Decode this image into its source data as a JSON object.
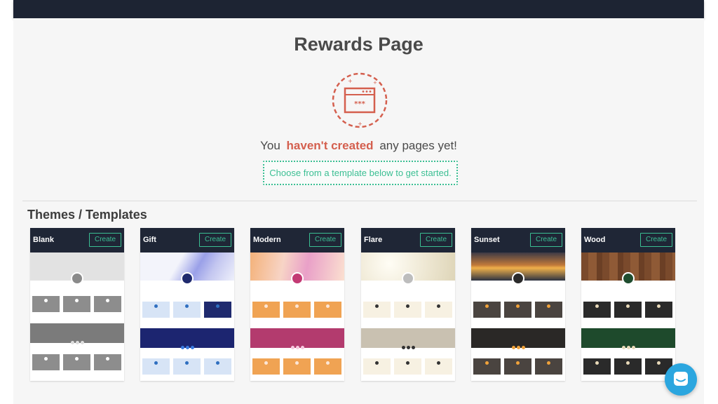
{
  "page": {
    "title": "Rewards Page",
    "empty_state": {
      "prefix": "You",
      "highlight": "haven't created",
      "suffix": "any pages yet!",
      "cta": "Choose from a template below to get started."
    }
  },
  "templates_section": {
    "title": "Themes / Templates",
    "create_label": "Create",
    "templates": [
      {
        "name": "Blank"
      },
      {
        "name": "Gift"
      },
      {
        "name": "Modern"
      },
      {
        "name": "Flare"
      },
      {
        "name": "Sunset"
      },
      {
        "name": "Wood"
      }
    ]
  },
  "colors": {
    "topbar": "#1d2433",
    "accent_green": "#3bbf93",
    "highlight_red": "#d45f4e",
    "chat_blue": "#2ba6df"
  },
  "icons": [
    "rewards-page-icon",
    "chat-icon"
  ]
}
